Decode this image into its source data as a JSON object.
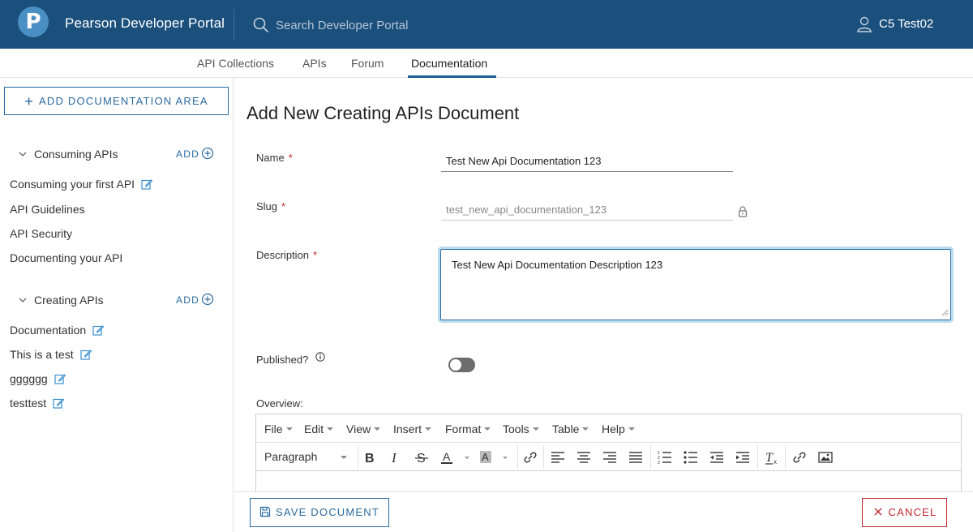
{
  "header": {
    "logo_letter": "P",
    "portal_title": "Pearson Developer Portal",
    "search_placeholder": "Search Developer Portal",
    "user_name": "C5 Test02"
  },
  "tabs": [
    {
      "label": "API Collections"
    },
    {
      "label": "APIs"
    },
    {
      "label": "Forum"
    },
    {
      "label": "Documentation",
      "active": true
    }
  ],
  "sidebar": {
    "add_area_label": "ADD DOCUMENTATION AREA",
    "groups": [
      {
        "title": "Consuming APIs",
        "add_label": "ADD",
        "items": [
          {
            "label": "Consuming your first API",
            "editable": true
          },
          {
            "label": "API Guidelines",
            "editable": false
          },
          {
            "label": "API Security",
            "editable": false
          },
          {
            "label": "Documenting your API",
            "editable": false
          }
        ]
      },
      {
        "title": "Creating APIs",
        "add_label": "ADD",
        "items": [
          {
            "label": "Documentation",
            "editable": true
          },
          {
            "label": "This is a test",
            "editable": true
          },
          {
            "label": "gggggg",
            "editable": true
          },
          {
            "label": "testtest",
            "editable": true
          }
        ]
      }
    ]
  },
  "form": {
    "title": "Add New Creating APIs Document",
    "name_label": "Name",
    "name_value": "Test New Api Documentation 123",
    "slug_label": "Slug",
    "slug_value": "test_new_api_documentation_123",
    "description_label": "Description",
    "description_value": "Test New Api Documentation Description 123",
    "required_mark": "*",
    "published_label": "Published?",
    "published_value": false,
    "overview_label": "Overview:"
  },
  "editor": {
    "menus": [
      "File",
      "Edit",
      "View",
      "Insert",
      "Format",
      "Tools",
      "Table",
      "Help"
    ],
    "block_format": "Paragraph",
    "toolbar_icons": [
      "bold-icon",
      "italic-icon",
      "strikethrough-icon",
      "text-color-icon",
      "background-color-icon",
      "link-icon",
      "align-left-icon",
      "align-center-icon",
      "align-right-icon",
      "align-justify-icon",
      "numbered-list-icon",
      "bullet-list-icon",
      "outdent-icon",
      "indent-icon",
      "clear-formatting-icon",
      "unlink-icon",
      "image-icon"
    ]
  },
  "footer": {
    "save_label": "SAVE DOCUMENT",
    "cancel_label": "CANCEL"
  },
  "colors": {
    "header_bg": "#1b4f7c",
    "accent": "#2b6aa0",
    "danger": "#c1272d",
    "focus_ring": "#b8dcf0"
  }
}
